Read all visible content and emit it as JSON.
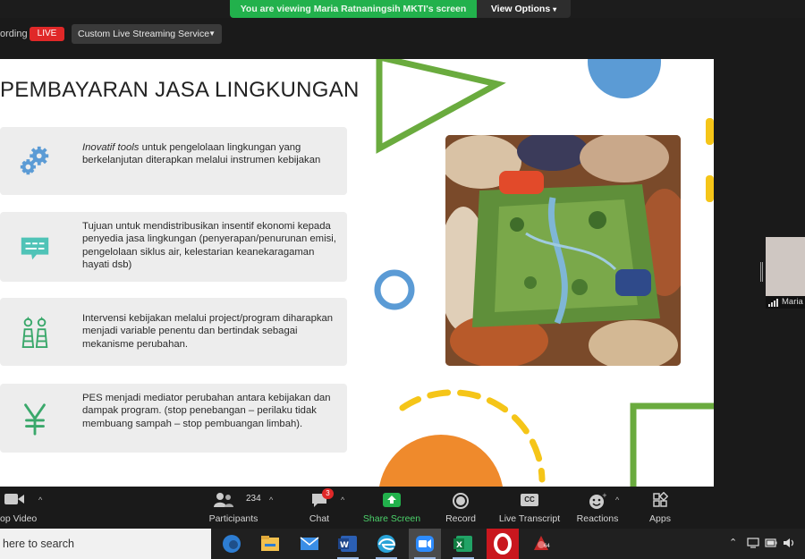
{
  "banner": {
    "viewing_text": "You are viewing Maria Ratnaningsih MKTI's screen",
    "view_options": "View Options"
  },
  "recording": {
    "label": "ording",
    "live_badge": "LIVE",
    "stream_service": "Custom Live Streaming Service"
  },
  "slide": {
    "title": "PEMBAYARAN JASA LINGKUNGAN",
    "items": [
      {
        "icon": "gears-icon",
        "emphasis": "Inovatif tools",
        "text": " untuk pengelolaan lingkungan yang berkelanjutan diterapkan melalui instrumen kebijakan"
      },
      {
        "icon": "message-icon",
        "emphasis": "",
        "text": "Tujuan untuk mendistribusikan insentif ekonomi kepada penyedia jasa lingkungan (penyerapan/penurunan emisi, pengelolaan siklus air, kelestarian keanekaragaman hayati dsb)"
      },
      {
        "icon": "people-icon",
        "emphasis": "",
        "text": "Intervensi kebijakan melalui project/program diharapkan menjadi variable penentu dan bertindak sebagai mekanisme perubahan."
      },
      {
        "icon": "yen-icon",
        "emphasis": "",
        "text": "PES menjadi mediator perubahan antara kebijakan dan dampak program. (stop penebangan – perilaku tidak membuang sampah – stop pembuangan limbah)."
      }
    ],
    "colors": {
      "accent_green": "#6aab3e",
      "accent_blue": "#5b9bd5",
      "accent_yellow": "#f5c518",
      "accent_orange": "#ef8a2c",
      "icon_teal": "#4fc3b7"
    }
  },
  "participant": {
    "name": "Maria"
  },
  "toolbar": {
    "stop_video": "op Video",
    "participants": "Participants",
    "participant_count": "234",
    "chat": "Chat",
    "chat_badge": "3",
    "share_screen": "Share Screen",
    "record": "Record",
    "live_transcript": "Live Transcript",
    "cc_label": "CC",
    "reactions": "Reactions",
    "apps": "Apps"
  },
  "taskbar": {
    "search_placeholder": "here to search",
    "apps": [
      "edge-icon",
      "file-explorer-icon",
      "mail-icon",
      "word-icon",
      "edge-browser-icon",
      "zoom-icon",
      "excel-icon",
      "opera-icon",
      "app-icon"
    ],
    "active_app": "zoom-icon",
    "app_badge": "64"
  }
}
